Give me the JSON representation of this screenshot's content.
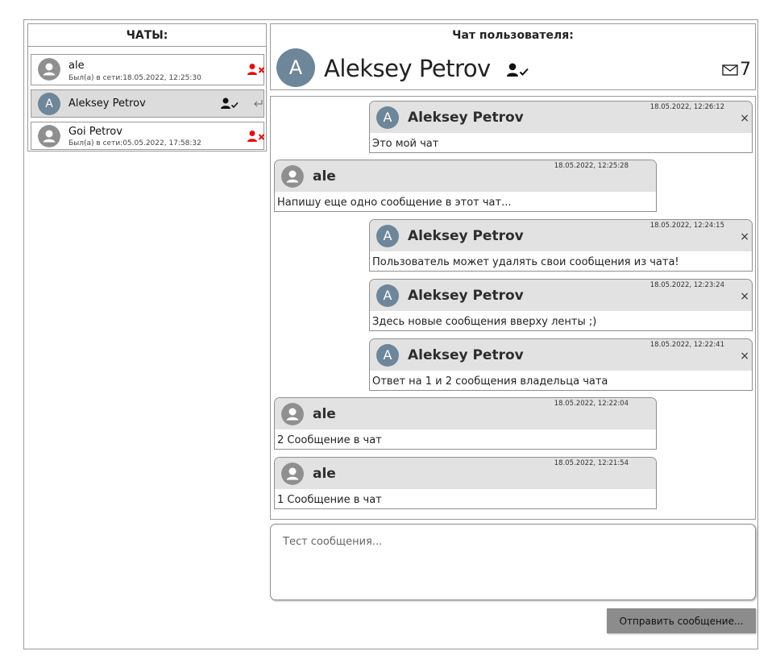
{
  "sidebar": {
    "title": "ЧАТЫ:",
    "chats": [
      {
        "name": "ale",
        "last_seen": "Был(а) в сети:18.05.2022, 12:25:30",
        "avatar_letter": ""
      },
      {
        "name": "Aleksey Petrov",
        "last_seen": "",
        "avatar_letter": "A"
      },
      {
        "name": "Goi Petrov",
        "last_seen": "Был(а) в сети:05.05.2022, 17:58:32",
        "avatar_letter": ""
      }
    ]
  },
  "header": {
    "title": "Чат пользователя:",
    "avatar_letter": "A",
    "user_name": "Aleksey Petrov",
    "message_count": "7"
  },
  "messages": [
    {
      "author": "Aleksey Petrov",
      "avatar_letter": "A",
      "time": "18.05.2022, 12:26:12",
      "text": "Это мой чат",
      "own": true
    },
    {
      "author": "ale",
      "avatar_letter": "",
      "time": "18.05.2022, 12:25:28",
      "text": "Напишу еще одно сообщение в этот чат...",
      "own": false
    },
    {
      "author": "Aleksey Petrov",
      "avatar_letter": "A",
      "time": "18.05.2022, 12:24:15",
      "text": "Пользователь может удалять свои сообщения из чата!",
      "own": true
    },
    {
      "author": "Aleksey Petrov",
      "avatar_letter": "A",
      "time": "18.05.2022, 12:23:24",
      "text": "Здесь новые сообщения вверху ленты ;)",
      "own": true
    },
    {
      "author": "Aleksey Petrov",
      "avatar_letter": "A",
      "time": "18.05.2022, 12:22:41",
      "text": "Ответ на 1 и 2 сообщения владельца чата",
      "own": true
    },
    {
      "author": "ale",
      "avatar_letter": "",
      "time": "18.05.2022, 12:22:04",
      "text": "2 Сообщение в чат",
      "own": false
    },
    {
      "author": "ale",
      "avatar_letter": "",
      "time": "18.05.2022, 12:21:54",
      "text": "1 Сообщение в чат",
      "own": false
    }
  ],
  "message_delete_glyph": "×",
  "composer": {
    "placeholder": "Тест сообщения...",
    "send_label": "Отправить сообщение..."
  },
  "colors": {
    "avatar_blue": "#6e8699",
    "avatar_gray": "#8f8f8f",
    "offline_icon": "#e01010",
    "message_header": "#e2e2e2",
    "active_chat": "#dcdcdc",
    "send_button": "#8c8c8c"
  },
  "icons": {
    "offline": "person-remove-icon",
    "online": "person-check-icon",
    "reply": "reply-arrow-icon",
    "messages": "mail-icon",
    "delete": "close-icon",
    "default_avatar": "user-circle-icon"
  }
}
